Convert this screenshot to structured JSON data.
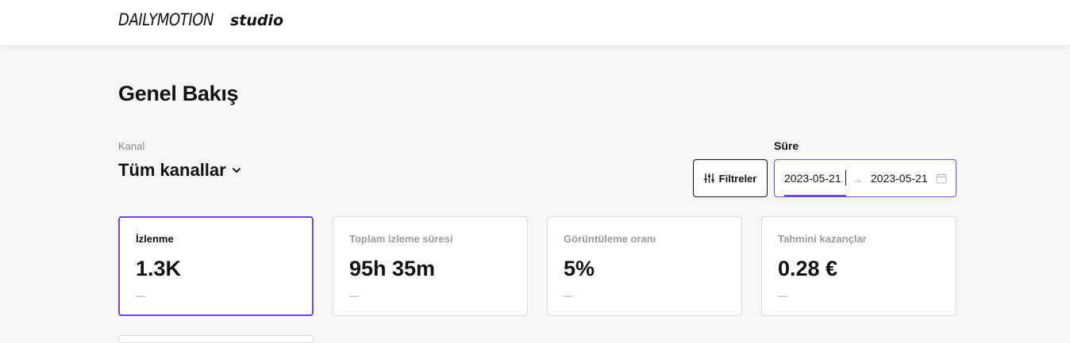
{
  "header": {
    "logo_main": "DAILYMOTION",
    "logo_sub": "studio"
  },
  "page": {
    "title": "Genel Bakış"
  },
  "channel": {
    "label": "Kanal",
    "selected": "Tüm kanallar"
  },
  "period": {
    "label": "Süre",
    "start": "2023-05-21",
    "arrow": "→",
    "end": "2023-05-21"
  },
  "filters": {
    "label": "Filtreler"
  },
  "metrics": [
    {
      "title": "İzlenme",
      "value": "1.3K",
      "delta": "—"
    },
    {
      "title": "Toplam izleme süresi",
      "value": "95h 35m",
      "delta": "—"
    },
    {
      "title": "Görüntüleme oranı",
      "value": "5%",
      "delta": "—"
    },
    {
      "title": "Tahmini kazançlar",
      "value": "0.28 €",
      "delta": "—"
    }
  ],
  "colors": {
    "accent": "#6c4bd1",
    "text": "#121212",
    "muted": "#9a9aa0",
    "background": "#f6f6f7"
  }
}
